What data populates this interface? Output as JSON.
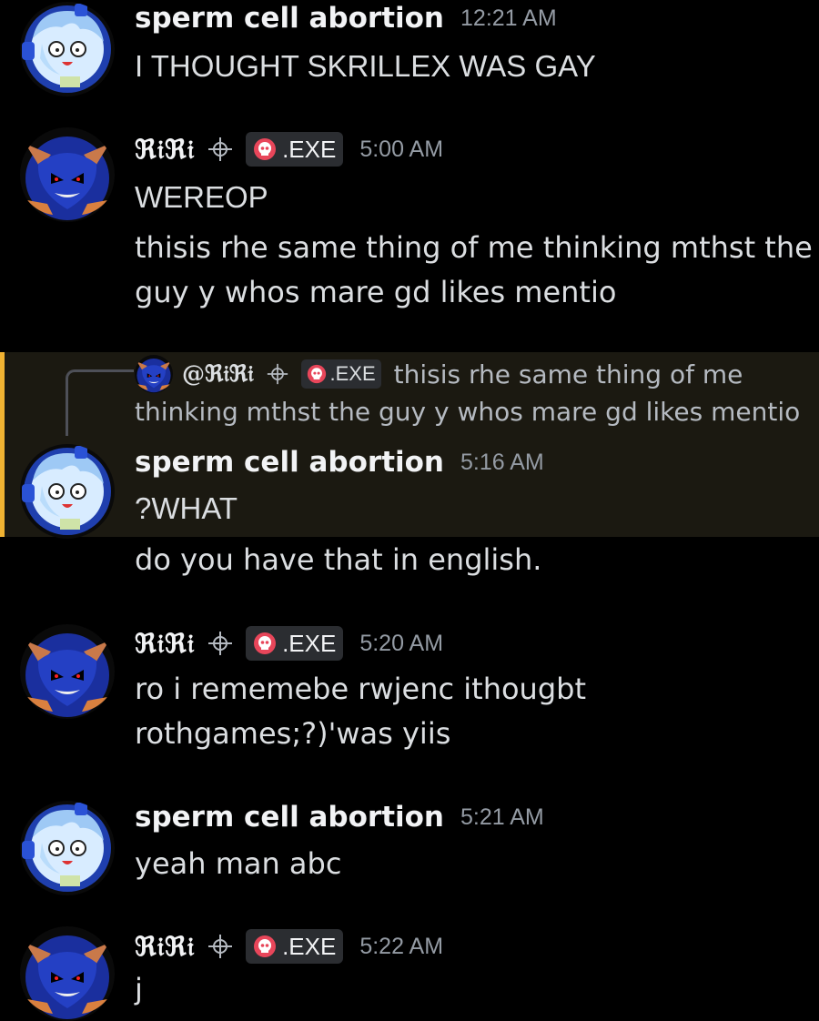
{
  "messages": [
    {
      "author": "sperm cell abortion",
      "time": "12:21 AM",
      "lines": [
        "I THOUGHT SKRILLEX WAS GAY"
      ]
    },
    {
      "author": "ℜ𝔦ℜ𝔦",
      "tag": ".EXE",
      "time": "5:00 AM",
      "lines": [
        "WEREOP",
        "thisis rhe same thing of me thinking mthst the",
        "guy y whos mare gd likes mentio"
      ]
    },
    {
      "reply": {
        "mention": "@ℜ𝔦ℜ𝔦",
        "tag": ".EXE",
        "text_line1": "thisis rhe same thing of me",
        "text_line2": "thinking mthst the guy y whos mare gd likes mentio"
      },
      "author": "sperm cell abortion",
      "time": "5:16 AM",
      "lines": [
        "?WHAT",
        "do you have that in english."
      ]
    },
    {
      "author": "ℜ𝔦ℜ𝔦",
      "tag": ".EXE",
      "time": "5:20 AM",
      "lines": [
        "ro i rememebe rwjenc ithougbt",
        "rothgames;?)'was yiis"
      ]
    },
    {
      "author": "sperm cell abortion",
      "time": "5:21 AM",
      "lines": [
        "yeah man abc"
      ]
    },
    {
      "author": "ℜ𝔦ℜ𝔦",
      "tag": ".EXE",
      "time": "5:22 AM",
      "lines": [
        "j"
      ]
    }
  ],
  "colors": {
    "background": "#000000",
    "reply_highlight": "#1b1911",
    "reply_bar": "#f0b232",
    "tag_bg": "#2b2d31",
    "timestamp": "#949ba4"
  },
  "icons": {
    "avatar_1": "anime-girl-avatar-icon",
    "avatar_2": "sonic-exe-avatar-icon",
    "crosshair": "crosshair-icon",
    "skull": "skull-icon"
  }
}
